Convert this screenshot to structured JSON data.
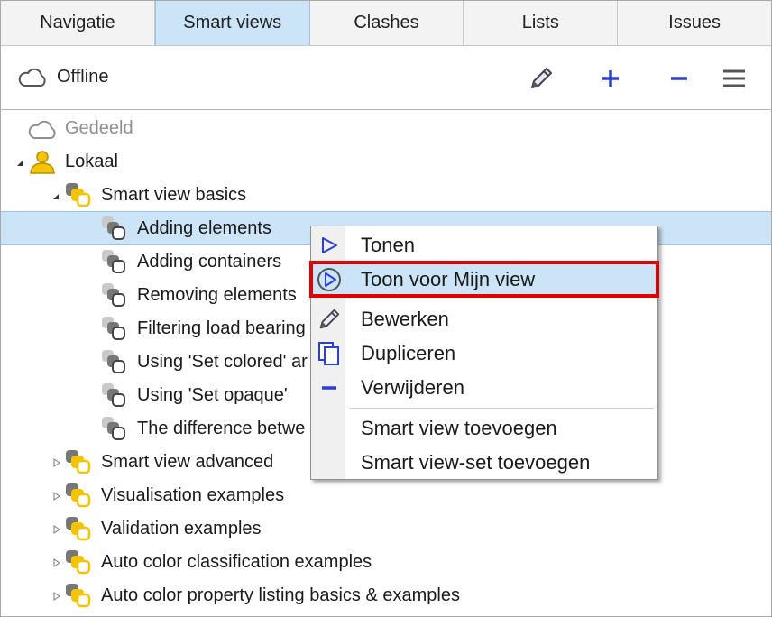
{
  "tabs": [
    {
      "label": "Navigatie",
      "active": false
    },
    {
      "label": "Smart views",
      "active": true
    },
    {
      "label": "Clashes",
      "active": false
    },
    {
      "label": "Lists",
      "active": false
    },
    {
      "label": "Issues",
      "active": false
    }
  ],
  "toolbar": {
    "status_label": "Offline",
    "status_icon": "cloud-icon",
    "buttons": [
      {
        "name": "edit-button",
        "icon": "pencil-icon"
      },
      {
        "name": "add-button",
        "icon": "plus-icon"
      },
      {
        "name": "remove-button",
        "icon": "minus-icon"
      },
      {
        "name": "menu-button",
        "icon": "hamburger-icon"
      }
    ]
  },
  "tree": {
    "shared": {
      "label": "Gedeeld",
      "icon": "cloud-icon"
    },
    "local": {
      "label": "Lokaal",
      "icon": "user-icon"
    },
    "basics": {
      "label": "Smart view basics"
    },
    "items": [
      {
        "label": "Adding elements",
        "selected": true
      },
      {
        "label": "Adding containers"
      },
      {
        "label": "Removing elements"
      },
      {
        "label": "Filtering load bearing"
      },
      {
        "label": "Using 'Set colored' ar"
      },
      {
        "label": "Using 'Set opaque'"
      },
      {
        "label": "The difference betwe"
      }
    ],
    "sets": [
      {
        "label": "Smart view advanced"
      },
      {
        "label": "Visualisation examples"
      },
      {
        "label": "Validation examples"
      },
      {
        "label": "Auto color classification examples"
      },
      {
        "label": "Auto color property listing basics & examples"
      }
    ]
  },
  "context_menu": {
    "items": [
      {
        "label": "Tonen",
        "icon": "play-icon"
      },
      {
        "label": "Toon voor Mijn view",
        "icon": "play-circle-icon",
        "highlighted": true
      },
      {
        "label": "Bewerken",
        "icon": "pencil-icon"
      },
      {
        "label": "Dupliceren",
        "icon": "copy-icon"
      },
      {
        "label": "Verwijderen",
        "icon": "minus-icon"
      },
      {
        "label": "Smart view toevoegen",
        "icon": ""
      },
      {
        "label": "Smart view-set toevoegen",
        "icon": ""
      }
    ]
  },
  "colors": {
    "accent_blue": "#2b3fd6",
    "selection": "#cce4f7",
    "highlight_border": "#e00000",
    "set_yellow": "#f5c400"
  }
}
